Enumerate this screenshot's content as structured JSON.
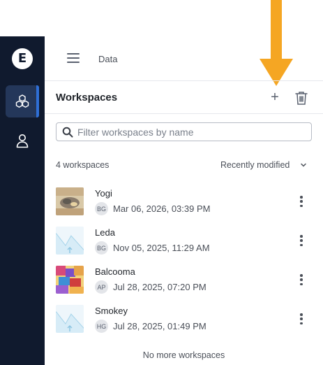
{
  "annotation": {
    "arrow_color": "#f5a623",
    "icon": "arrow-down-icon"
  },
  "sidebar": {
    "logo_letter": "E",
    "items": [
      {
        "icon": "cubes-icon",
        "active": true
      },
      {
        "icon": "user-icon",
        "active": false
      }
    ],
    "colors": {
      "background": "#101a2e",
      "active": "#24375a",
      "accent": "#2f6fd6"
    }
  },
  "topbar": {
    "menu_icon": "hamburger-menu-icon",
    "breadcrumb": "Data"
  },
  "workspaces": {
    "title": "Workspaces",
    "add_label": "+",
    "delete_icon": "trash-icon",
    "search": {
      "placeholder": "Filter workspaces by name",
      "value": ""
    },
    "count_label": "4 workspaces",
    "sort_label": "Recently modified",
    "items": [
      {
        "name": "Yogi",
        "owner_initials": "BG",
        "modified": "Mar 06, 2026, 03:39 PM",
        "thumbnail": "image-thumbnail"
      },
      {
        "name": "Leda",
        "owner_initials": "BG",
        "modified": "Nov 05, 2025, 11:29 AM",
        "thumbnail": "placeholder-thumbnail"
      },
      {
        "name": "Balcooma",
        "owner_initials": "AP",
        "modified": "Jul 28, 2025, 07:20 PM",
        "thumbnail": "image-thumbnail"
      },
      {
        "name": "Smokey",
        "owner_initials": "HG",
        "modified": "Jul 28, 2025, 01:49 PM",
        "thumbnail": "placeholder-thumbnail"
      }
    ],
    "end_label": "No more workspaces"
  }
}
